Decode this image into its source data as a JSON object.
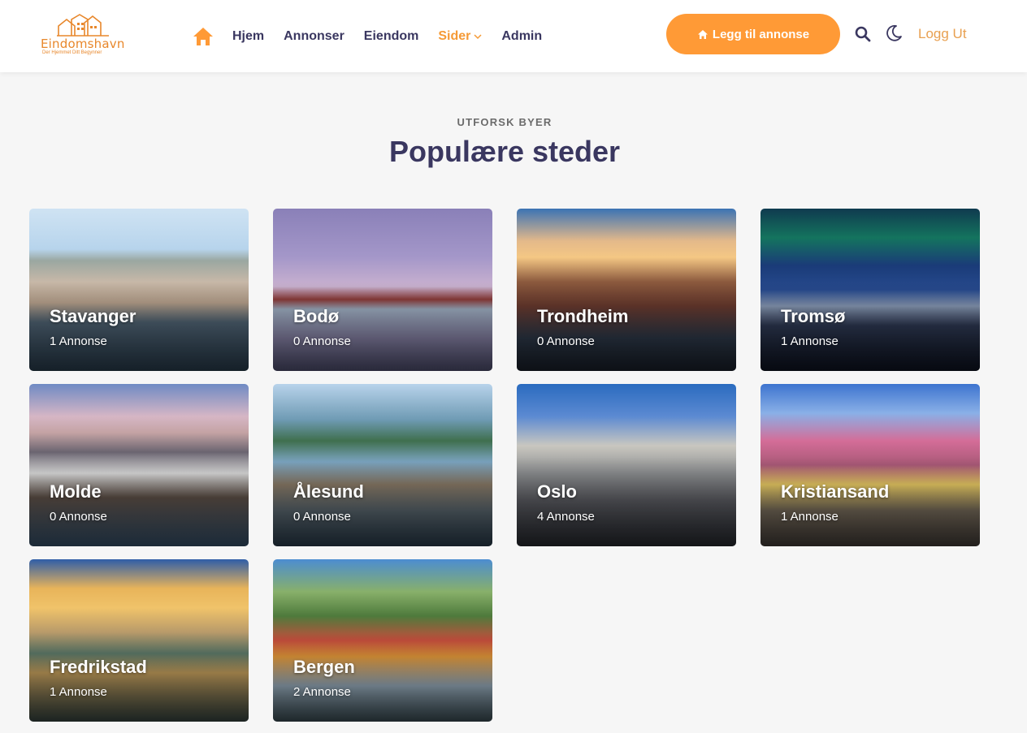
{
  "header": {
    "logo": {
      "name": "Eindomshavn",
      "tagline": "Der Hjemmet Ditt Begynner"
    },
    "nav": [
      {
        "label": "Hjem",
        "active": false
      },
      {
        "label": "Annonser",
        "active": false
      },
      {
        "label": "Eiendom",
        "active": false
      },
      {
        "label": "Sider",
        "active": true,
        "dropdown": true
      },
      {
        "label": "Admin",
        "active": false
      }
    ],
    "add_button_label": "Legg til annonse",
    "logout_label": "Logg Ut",
    "icons": [
      "home-icon",
      "search-icon",
      "moon-icon"
    ],
    "colors": {
      "accent": "#ff9a36",
      "nav_text": "#3a3760"
    }
  },
  "section": {
    "eyebrow": "UTFORSK BYER",
    "title": "Populære steder"
  },
  "cities": [
    {
      "name": "Stavanger",
      "count": "1 Annonse"
    },
    {
      "name": "Bodø",
      "count": "0 Annonse"
    },
    {
      "name": "Trondheim",
      "count": "0 Annonse"
    },
    {
      "name": "Tromsø",
      "count": "1 Annonse"
    },
    {
      "name": "Molde",
      "count": "0 Annonse"
    },
    {
      "name": "Ålesund",
      "count": "0 Annonse"
    },
    {
      "name": "Oslo",
      "count": "4 Annonse"
    },
    {
      "name": "Kristiansand",
      "count": "1 Annonse"
    },
    {
      "name": "Fredrikstad",
      "count": "1 Annonse"
    },
    {
      "name": "Bergen",
      "count": "2 Annonse"
    }
  ]
}
